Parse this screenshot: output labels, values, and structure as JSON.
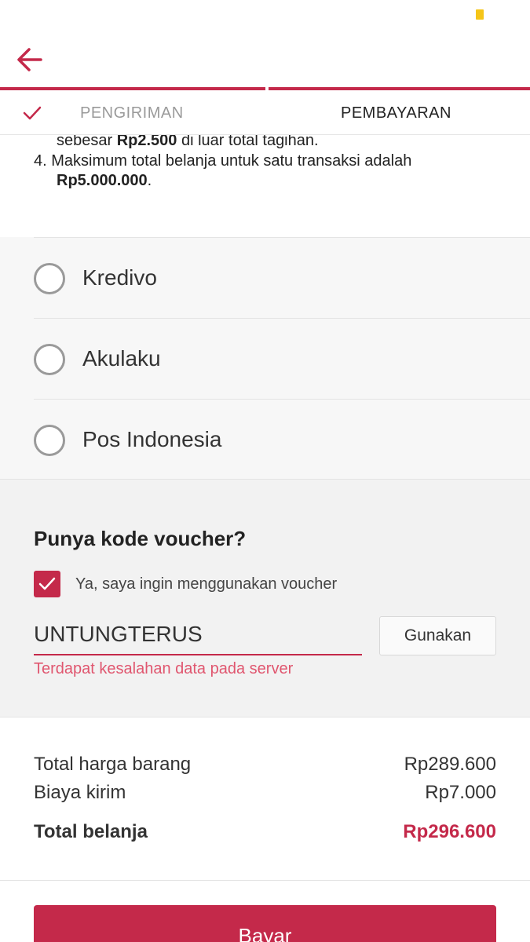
{
  "colors": {
    "accent": "#c4294a",
    "error": "#e0566f",
    "battery": "#f5c518"
  },
  "header": {
    "back_icon": "arrow-left-icon"
  },
  "steps": [
    {
      "label": "PENGIRIMAN",
      "status": "completed",
      "icon": "check-icon"
    },
    {
      "label": "PEMBAYARAN",
      "status": "active"
    }
  ],
  "terms": {
    "line3_pre": "sebesar ",
    "line3_bold": "Rp2.500",
    "line3_post": " di luar total tagihan.",
    "line4_text": "4. Maksimum total belanja untuk satu transaksi adalah",
    "line4_bold": "Rp5.000.000",
    "line4_post": "."
  },
  "payment_methods": [
    {
      "label": "Kredivo",
      "selected": false
    },
    {
      "label": "Akulaku",
      "selected": false
    },
    {
      "label": "Pos Indonesia",
      "selected": false
    }
  ],
  "voucher": {
    "title": "Punya kode voucher?",
    "checkbox_label": "Ya, saya ingin menggunakan voucher",
    "checked": true,
    "code": "UNTUNGTERUS",
    "apply_label": "Gunakan",
    "error": "Terdapat kesalahan data pada server"
  },
  "summary": {
    "items_label": "Total harga barang",
    "items_value": "Rp289.600",
    "shipping_label": "Biaya kirim",
    "shipping_value": "Rp7.000",
    "total_label": "Total belanja",
    "total_value": "Rp296.600"
  },
  "pay_button": "Bayar"
}
